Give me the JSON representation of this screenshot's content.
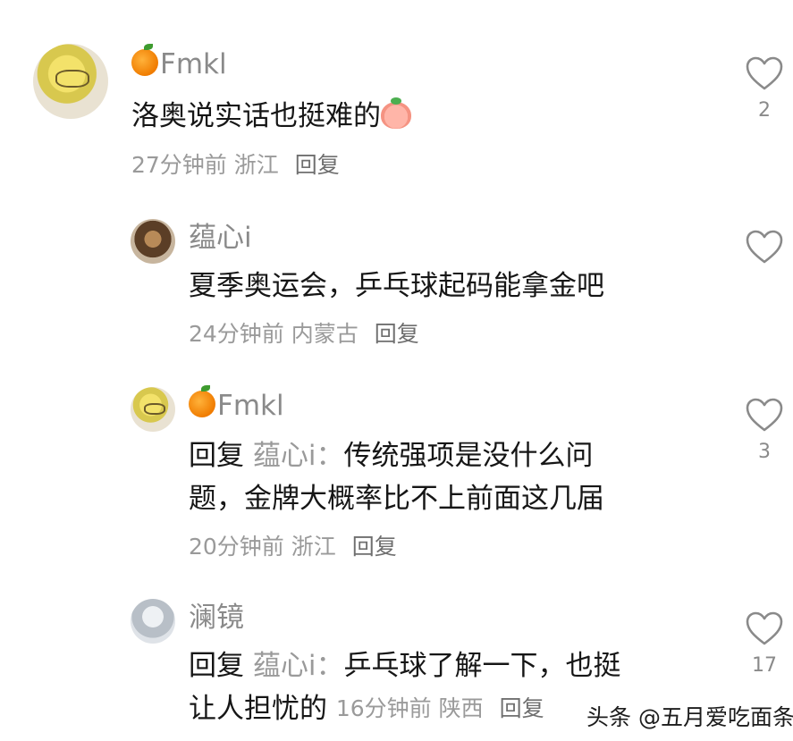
{
  "comments": [
    {
      "user": "Fmkl",
      "text": "洛奥说实话也挺难的",
      "time": "27分钟前",
      "location": "浙江",
      "reply_label": "回复",
      "likes": "2"
    },
    {
      "user": "蕴心i",
      "text": "夏季奥运会，乒乓球起码能拿金吧",
      "time": "24分钟前",
      "location": "内蒙古",
      "reply_label": "回复",
      "likes": ""
    },
    {
      "user": "Fmkl",
      "reply_prefix": "回复",
      "reply_target": "蕴心i：",
      "text_line1": "传统强项是没什么问",
      "text_line2": "题，金牌大概率比不上前面这几届",
      "time": "20分钟前",
      "location": "浙江",
      "reply_label": "回复",
      "likes": "3"
    },
    {
      "user": "澜镜",
      "reply_prefix": "回复",
      "reply_target": "蕴心i：",
      "text_line1": "乒乓球了解一下，也挺",
      "text_line2": "让人担忧的",
      "time": "16分钟前",
      "location": "陕西",
      "reply_label": "回复",
      "likes": "17"
    }
  ],
  "watermark": "头条 @五月爱吃面条",
  "icons": {
    "like": "heart-outline-icon",
    "user_badge": "orange-emoji-icon",
    "text_emoji": "crying-face-emoji-icon"
  },
  "colors": {
    "text": "#161616",
    "secondary": "#8a8a8a",
    "meta": "#9a9a9a"
  }
}
